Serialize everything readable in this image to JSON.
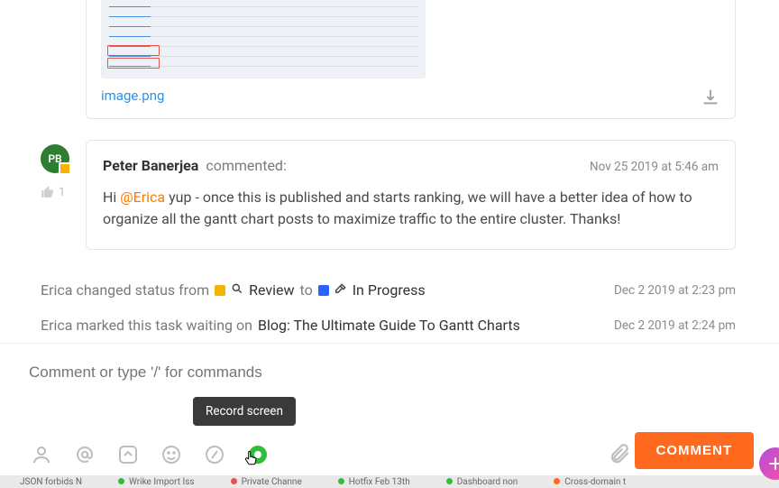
{
  "attachment": {
    "filename": "image.png"
  },
  "comment": {
    "avatar_initials": "PB",
    "author": "Peter Banerjea",
    "verb": "commented:",
    "timestamp": "Nov 25 2019 at 5:46 am",
    "like_count": "1",
    "body_prefix": "Hi ",
    "mention": "@Erica",
    "body_rest": " yup - once this is published and starts ranking, we will have a better idea of how to organize all the gantt chart posts to maximize traffic to the entire cluster. Thanks!"
  },
  "activity1": {
    "prefix": "Erica changed status from",
    "from_label": "Review",
    "mid": "to",
    "to_label": "In Progress",
    "timestamp": "Dec 2 2019 at 2:23 pm"
  },
  "activity2": {
    "prefix": "Erica marked this task waiting on",
    "task": "Blog: The Ultimate Guide To Gantt Charts",
    "timestamp": "Dec 2 2019 at 2:24 pm"
  },
  "composer": {
    "placeholder": "Comment or type '/' for commands",
    "tooltip": "Record screen",
    "submit": "COMMENT"
  },
  "tabs": {
    "t1": "JSON forbids N",
    "t2": "Wrike Import Iss",
    "t3": "Private Channe",
    "t4": "Hotfix Feb 13th",
    "t5": "Dashboard non",
    "t6": "Cross-domain t"
  }
}
